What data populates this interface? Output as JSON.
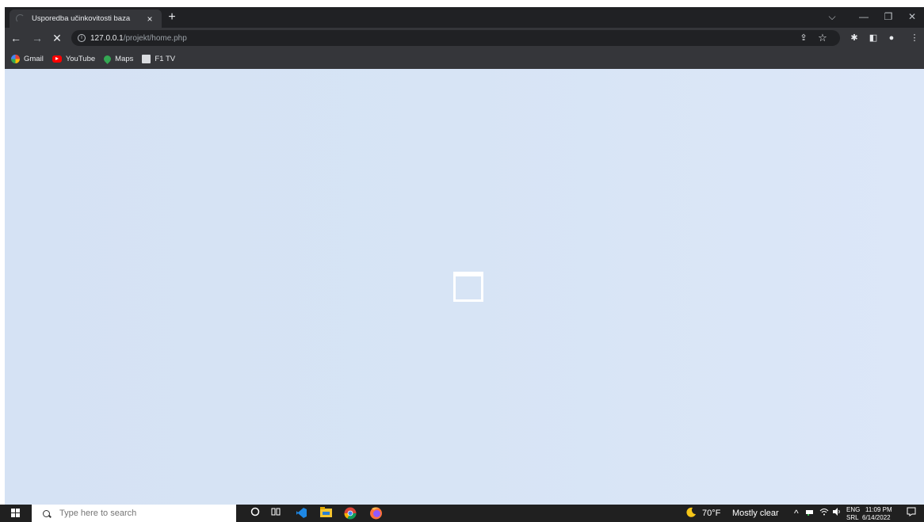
{
  "browser": {
    "tab": {
      "title": "Usporedba učinkovitosti baza",
      "close_glyph": "×"
    },
    "new_tab_glyph": "+",
    "window_controls": {
      "tab_search": "⌵",
      "minimize": "—",
      "restore": "❐",
      "close": "✕"
    },
    "nav": {
      "back": "←",
      "forward": "→",
      "stop": "✕"
    },
    "address": {
      "host": "127.0.0.1",
      "path": "/projekt/home.php"
    },
    "toolbar_icons": {
      "share": "⇪",
      "bookmark": "☆",
      "extensions": "✱",
      "side_panel": "◧",
      "profile": "●",
      "menu": "⋮"
    },
    "bookmarks": [
      {
        "label": "Gmail"
      },
      {
        "label": "YouTube"
      },
      {
        "label": "Maps"
      },
      {
        "label": "F1 TV"
      }
    ]
  },
  "taskbar": {
    "search_placeholder": "Type here to search",
    "weather": {
      "temp": "70°F",
      "condition": "Mostly clear"
    },
    "tray_chevron": "^",
    "language": {
      "line1": "ENG",
      "line2": "SRL"
    },
    "clock": {
      "time": "11:09 PM",
      "date": "6/14/2022"
    }
  },
  "colors": {
    "page_bg": "#d7e4f5",
    "chrome_dark": "#202124",
    "chrome_toolbar": "#35363a"
  }
}
